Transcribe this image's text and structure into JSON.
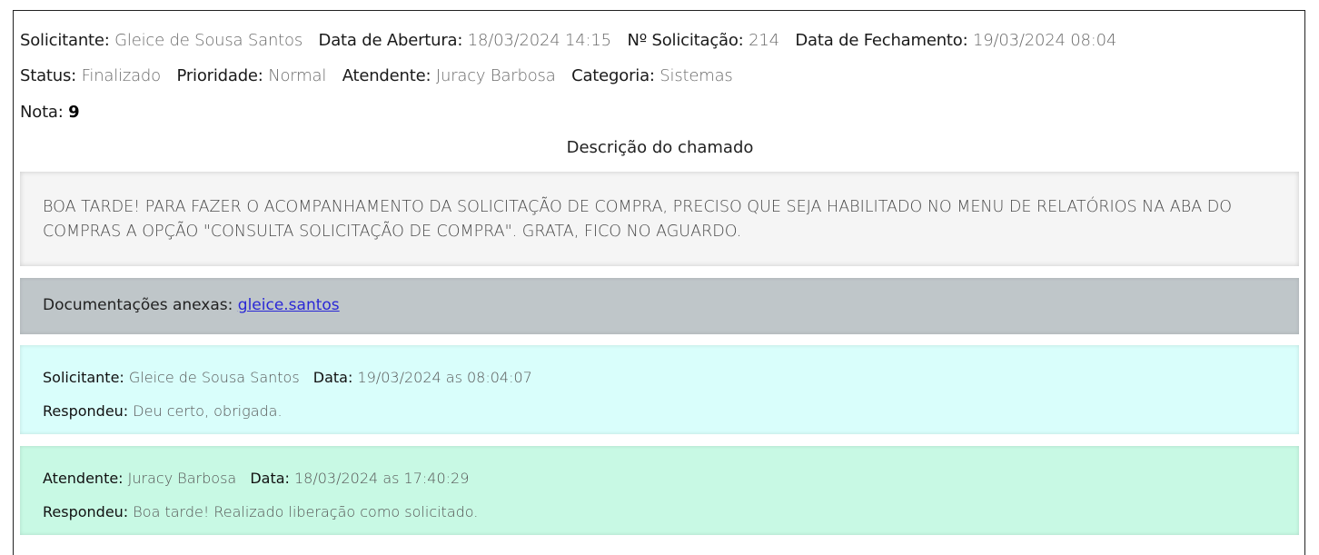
{
  "header": {
    "solicitante_label": "Solicitante:",
    "solicitante_value": "Gleice de Sousa Santos",
    "abertura_label": "Data de Abertura:",
    "abertura_value": "18/03/2024 14:15",
    "numero_label": "Nº Solicitação:",
    "numero_value": "214",
    "fechamento_label": "Data de Fechamento:",
    "fechamento_value": "19/03/2024 08:04",
    "status_label": "Status:",
    "status_value": "Finalizado",
    "prioridade_label": "Prioridade:",
    "prioridade_value": "Normal",
    "atendente_label": "Atendente:",
    "atendente_value": "Juracy Barbosa",
    "categoria_label": "Categoria:",
    "categoria_value": "Sistemas",
    "nota_label": "Nota:",
    "nota_value": "9"
  },
  "description": {
    "title": "Descrição do chamado",
    "text": "BOA TARDE! PARA FAZER O ACOMPANHAMENTO DA SOLICITAÇÃO DE COMPRA, PRECISO QUE SEJA HABILITADO NO MENU DE RELATÓRIOS NA ABA DO COMPRAS A OPÇÃO \"CONSULTA SOLICITAÇÃO DE COMPRA\". GRATA, FICO NO AGUARDO."
  },
  "attachments": {
    "label": "Documentações anexas:",
    "link": "gleice.santos"
  },
  "replies": [
    {
      "role_label": "Solicitante:",
      "name": "Gleice de Sousa Santos",
      "date_label": "Data:",
      "date": "19/03/2024",
      "time": "as 08:04:07",
      "response_label": "Respondeu:",
      "response": "Deu certo, obrigada.",
      "color": "#d9fefb"
    },
    {
      "role_label": "Atendente:",
      "name": "Juracy Barbosa",
      "date_label": "Data:",
      "date": "18/03/2024",
      "time": "as 17:40:29",
      "response_label": "Respondeu:",
      "response": "Boa tarde! Realizado liberação como solicitado.",
      "color": "#c8f9e4"
    }
  ]
}
